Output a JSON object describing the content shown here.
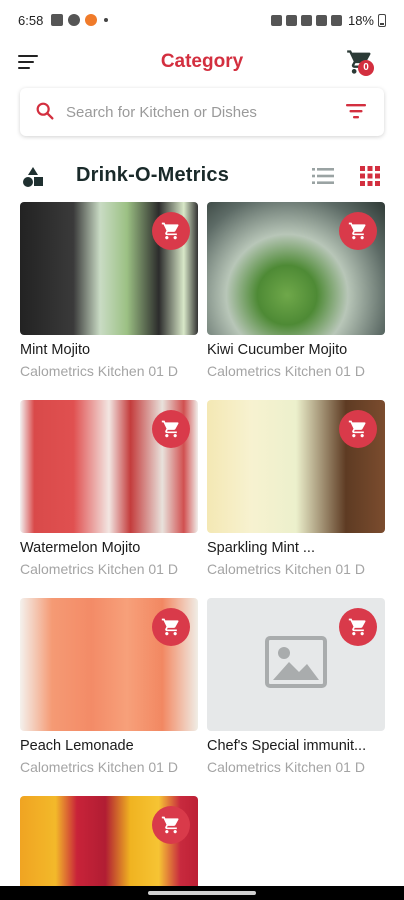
{
  "status_bar": {
    "time": "6:58",
    "battery": "18%"
  },
  "app_bar": {
    "title": "Category",
    "cart_count": "0"
  },
  "search": {
    "placeholder": "Search for Kitchen or Dishes",
    "value": ""
  },
  "section": {
    "title": "Drink-O-Metrics"
  },
  "products": [
    {
      "name": "Mint Mojito",
      "kitchen": "Calometrics Kitchen 01 D"
    },
    {
      "name": "Kiwi Cucumber Mojito",
      "kitchen": "Calometrics Kitchen 01 D"
    },
    {
      "name": "Watermelon Mojito",
      "kitchen": "Calometrics Kitchen 01 D"
    },
    {
      "name": "Sparkling Mint ...",
      "kitchen": "Calometrics Kitchen 01 D"
    },
    {
      "name": "Peach Lemonade",
      "kitchen": "Calometrics Kitchen 01 D"
    },
    {
      "name": "Chef's Special immunit...",
      "kitchen": "Calometrics Kitchen 01 D"
    },
    {
      "name": "",
      "kitchen": ""
    }
  ],
  "colors": {
    "accent": "#d32f3f",
    "cart_button": "#d93a4a",
    "title_text": "#1a2a2a",
    "muted_text": "#a4a4a4"
  },
  "icons": {
    "menu": "menu-icon",
    "cart": "cart-icon",
    "search": "search-icon",
    "filter": "filter-icon",
    "category": "category-shapes-icon",
    "list_view": "list-view-icon",
    "grid_view": "grid-view-icon",
    "add_to_cart": "add-to-cart-icon",
    "placeholder": "image-placeholder-icon"
  }
}
